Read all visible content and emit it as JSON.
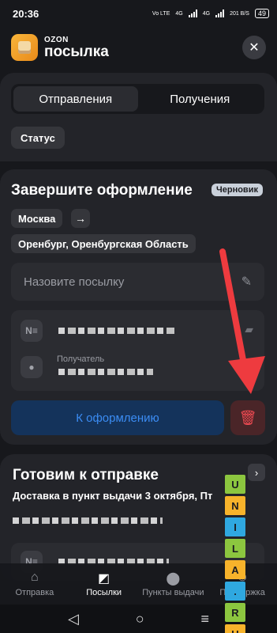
{
  "statusbar": {
    "time": "20:36",
    "net1": "Vo LTE",
    "net2": "4G",
    "net3": "4G",
    "speed": "201 B/S",
    "battery": "49"
  },
  "header": {
    "brand_small": "OZON",
    "brand_big": "посылка"
  },
  "tabs": {
    "sent": "Отправления",
    "received": "Получения"
  },
  "filter": {
    "status": "Статус"
  },
  "draft": {
    "title": "Завершите оформление",
    "badge": "Черновик",
    "from_city": "Москва",
    "arrow": "→",
    "to_city": "Оренбург, Оренбургская Область",
    "name_placeholder": "Назовите посылку",
    "recipient_label": "Получатель",
    "primary_button": "К оформлению"
  },
  "ready": {
    "title": "Готовим к отправке",
    "subtitle": "Доставка в пункт выдачи 3 октября, Пт",
    "arrow": "›"
  },
  "bottomnav": {
    "items": [
      {
        "label": "Отправка",
        "icon": "home-icon"
      },
      {
        "label": "Посылки",
        "icon": "box-icon"
      },
      {
        "label": "Пункты выдачи",
        "icon": "map-pin-icon"
      },
      {
        "label": "Поддержка",
        "icon": "support-icon"
      }
    ]
  },
  "watermark": {
    "letters": [
      "U",
      "N",
      "I",
      "L",
      "A",
      ".",
      "R",
      "U"
    ]
  },
  "colors": {
    "background": "#17181c",
    "card": "#232429",
    "primary_bg": "#14335b",
    "primary_text": "#3b8cf3",
    "delete_bg": "#4a2528",
    "delete_icon": "#f04a52",
    "annotation_arrow": "#ee3b3f"
  }
}
